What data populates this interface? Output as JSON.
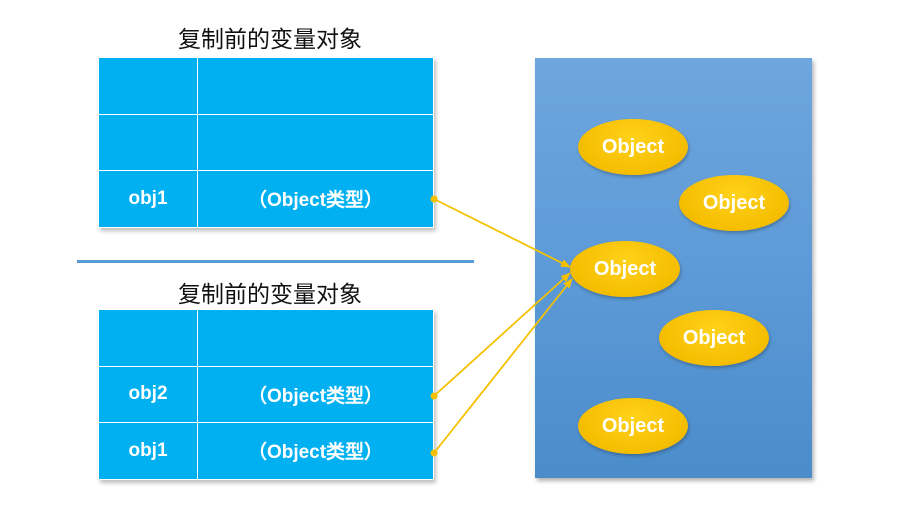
{
  "top_section": {
    "caption": "复制前的变量对象",
    "rows": [
      {
        "name": "",
        "value": ""
      },
      {
        "name": "",
        "value": ""
      },
      {
        "name": "obj1",
        "value": "（Object类型）"
      }
    ]
  },
  "bottom_section": {
    "caption": "复制前的变量对象",
    "rows": [
      {
        "name": "",
        "value": ""
      },
      {
        "name": "obj2",
        "value": "（Object类型）"
      },
      {
        "name": "obj1",
        "value": "（Object类型）"
      }
    ]
  },
  "heap": {
    "objects": [
      "Object",
      "Object",
      "Object",
      "Object",
      "Object"
    ]
  },
  "colors": {
    "cell_fill": "#00b0f0",
    "heap_fill": "#5d9ad7",
    "object_fill": "#f5bd00",
    "arrow": "#f5c000",
    "divider": "#5b9bd5"
  }
}
